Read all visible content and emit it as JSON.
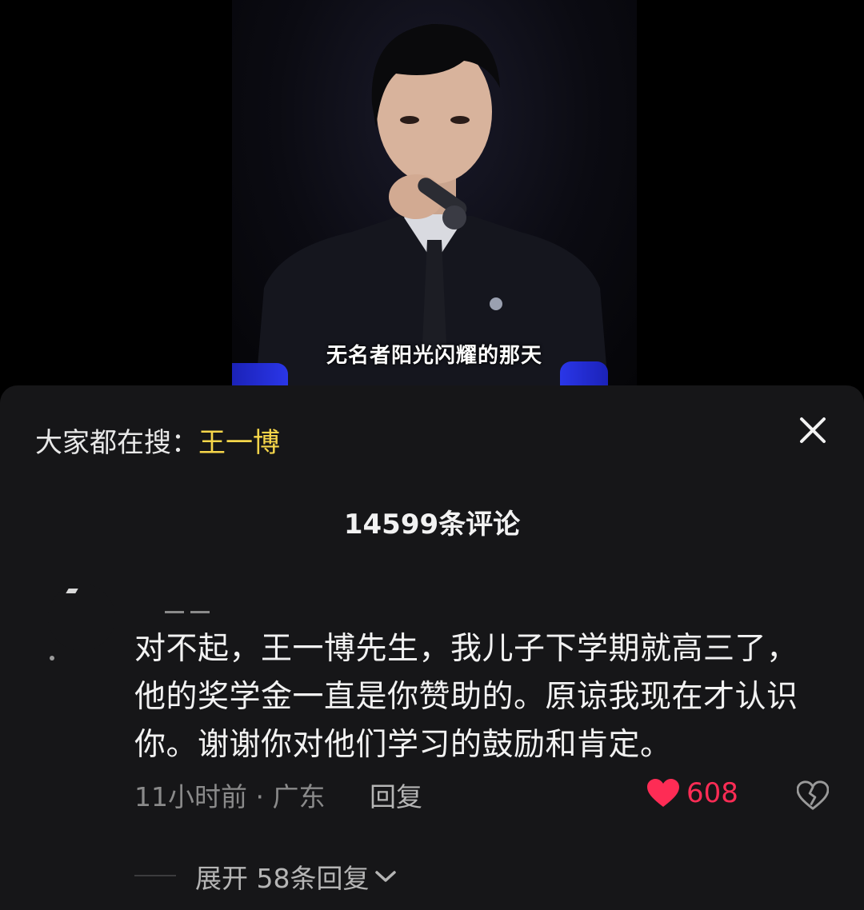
{
  "video": {
    "subtitle": "无名者阳光闪耀的那天"
  },
  "comment_panel": {
    "search_label": "大家都在搜：",
    "search_keyword": "王一博",
    "close_icon": "close-icon",
    "comment_count": "14599条评论"
  },
  "comment": {
    "text": "对不起，王一博先生，我儿子下学期就高三了，他的奖学金一直是你赞助的。原谅我现在才认识你。谢谢你对他们学习的鼓励和肯定。",
    "time_location": "11小时前 · 广东",
    "reply_label": "回复",
    "likes": "608",
    "like_icon": "heart-filled-icon",
    "like_color": "#fe2c55",
    "dislike_icon": "broken-heart-icon",
    "expand_label": "展开 58条回复",
    "expand_icon": "chevron-down-icon"
  }
}
